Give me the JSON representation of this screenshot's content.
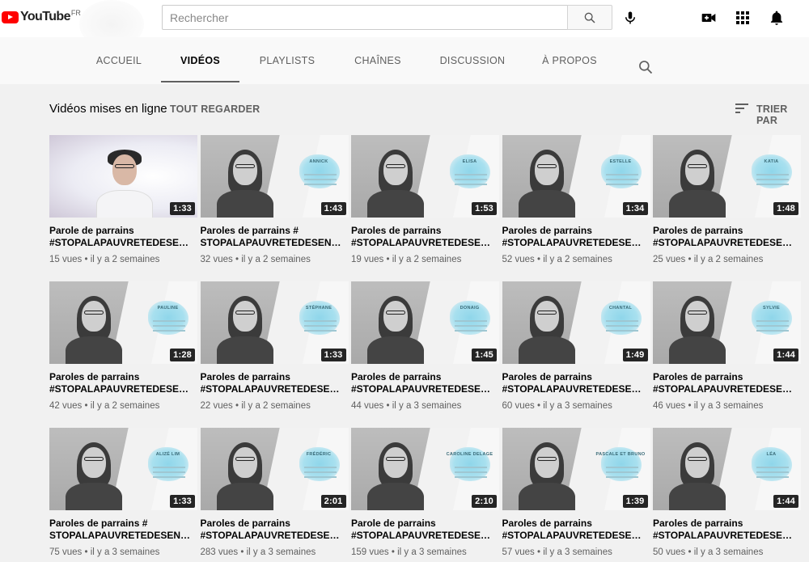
{
  "masthead": {
    "logo_text": "YouTube",
    "logo_country": "FR",
    "search_placeholder": "Rechercher"
  },
  "tabs": [
    {
      "label": "ACCUEIL",
      "active": false
    },
    {
      "label": "VIDÉOS",
      "active": true
    },
    {
      "label": "PLAYLISTS",
      "active": false
    },
    {
      "label": "CHAÎNES",
      "active": false
    },
    {
      "label": "DISCUSSION",
      "active": false
    },
    {
      "label": "À PROPOS",
      "active": false
    }
  ],
  "section": {
    "title": "Vidéos mises en ligne",
    "view_all": "TOUT REGARDER",
    "sort_label": "TRIER PAR"
  },
  "videos": [
    {
      "title": "Parole de parrains",
      "title2": "#STOPALAPAUVRETEDESE…",
      "views": "15 vues",
      "age": "il y a 2 semaines",
      "duration": "1:33",
      "thumb_name": ""
    },
    {
      "title": "Paroles de parrains #",
      "title2": "STOPALAPAUVRETEDESEN…",
      "views": "32 vues",
      "age": "il y a 2 semaines",
      "duration": "1:43",
      "thumb_name": "ANNICK"
    },
    {
      "title": "Paroles de parrains",
      "title2": "#STOPALAPAUVRETEDESE…",
      "views": "19 vues",
      "age": "il y a 2 semaines",
      "duration": "1:53",
      "thumb_name": "ELISA"
    },
    {
      "title": "Paroles de parrains",
      "title2": "#STOPALAPAUVRETEDESE…",
      "views": "52 vues",
      "age": "il y a 2 semaines",
      "duration": "1:34",
      "thumb_name": "ESTELLE"
    },
    {
      "title": "Paroles de parrains",
      "title2": "#STOPALAPAUVRETEDESE…",
      "views": "25 vues",
      "age": "il y a 2 semaines",
      "duration": "1:48",
      "thumb_name": "KATIA"
    },
    {
      "title": "Paroles de parrains",
      "title2": "#STOPALAPAUVRETEDESE…",
      "views": "42 vues",
      "age": "il y a 2 semaines",
      "duration": "1:28",
      "thumb_name": "PAULINE"
    },
    {
      "title": "Paroles de parrains",
      "title2": "#STOPALAPAUVRETEDESE…",
      "views": "22 vues",
      "age": "il y a 2 semaines",
      "duration": "1:33",
      "thumb_name": "STÉPHANE"
    },
    {
      "title": "Paroles de parrains",
      "title2": "#STOPALAPAUVRETEDESE…",
      "views": "44 vues",
      "age": "il y a 3 semaines",
      "duration": "1:45",
      "thumb_name": "DONAIG"
    },
    {
      "title": "Paroles de parrains",
      "title2": "#STOPALAPAUVRETEDESE…",
      "views": "60 vues",
      "age": "il y a 3 semaines",
      "duration": "1:49",
      "thumb_name": "CHANTAL"
    },
    {
      "title": "Paroles de parrains",
      "title2": "#STOPALAPAUVRETEDESE…",
      "views": "46 vues",
      "age": "il y a 3 semaines",
      "duration": "1:44",
      "thumb_name": "SYLVIE"
    },
    {
      "title": "Paroles de parrains #",
      "title2": "STOPALAPAUVRETEDESEN…",
      "views": "75 vues",
      "age": "il y a 3 semaines",
      "duration": "1:33",
      "thumb_name": "ALIZÉ LIM"
    },
    {
      "title": "Paroles de parrains",
      "title2": "#STOPALAPAUVRETEDESE…",
      "views": "283 vues",
      "age": "il y a 3 semaines",
      "duration": "2:01",
      "thumb_name": "FRÉDÉRIC"
    },
    {
      "title": "Parole de parrains",
      "title2": "#STOPALAPAUVRETEDESE…",
      "views": "159 vues",
      "age": "il y a 3 semaines",
      "duration": "2:10",
      "thumb_name": "CAROLINE DELAGE"
    },
    {
      "title": "Paroles de parrains",
      "title2": "#STOPALAPAUVRETEDESE…",
      "views": "57 vues",
      "age": "il y a 3 semaines",
      "duration": "1:39",
      "thumb_name": "PASCALE ET BRUNO"
    },
    {
      "title": "Paroles de parrains",
      "title2": "#STOPALAPAUVRETEDESE…",
      "views": "50 vues",
      "age": "il y a 3 semaines",
      "duration": "1:44",
      "thumb_name": "LÉA"
    }
  ]
}
